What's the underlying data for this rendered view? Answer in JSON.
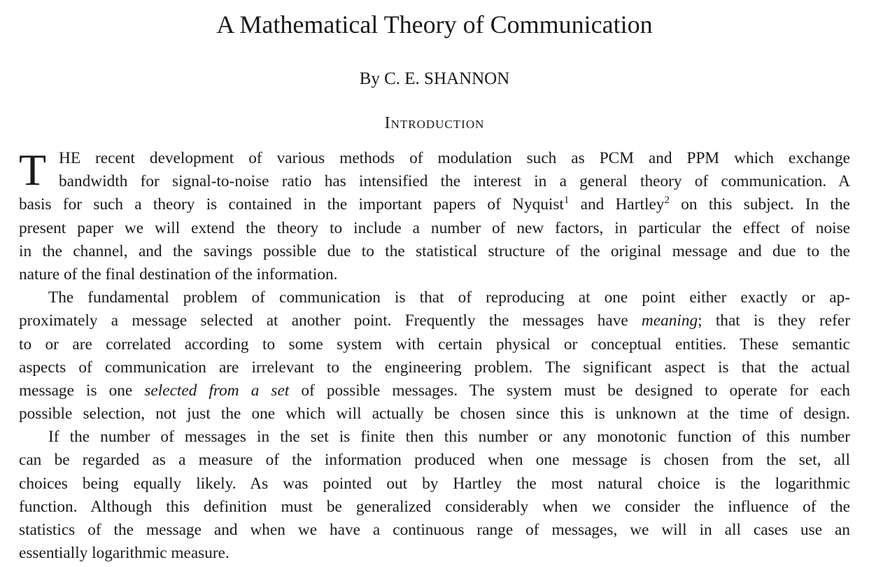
{
  "paper": {
    "title": "A Mathematical Theory of Communication",
    "author": "By C. E. SHANNON",
    "section_heading": "Introduction",
    "p1": {
      "dropcap": "T",
      "l1": "HE recent development of various methods of modulation such as PCM and PPM which exchange",
      "l2": "bandwidth for signal-to-noise ratio has intensified the interest in a general theory of communication. A",
      "l3a": "basis for such a theory is contained in the important papers of Nyquist",
      "l3_fn1": "1",
      "l3b": " and Hartley",
      "l3_fn2": "2",
      "l3c": " on this subject. In the",
      "l4": "present paper we will extend the theory to include a number of new factors, in particular the effect of noise",
      "l5": "in the channel, and the savings possible due to the statistical structure of the original message and due to the",
      "l6": "nature of the final destination of the information."
    },
    "p2": {
      "l1": "The fundamental problem of communication is that of reproducing at one point either exactly or ap-",
      "l2a": "proximately a message selected at another point. Frequently the messages have ",
      "l2_em": "meaning",
      "l2b": "; that is they refer",
      "l3": "to or are correlated according to some system with certain physical or conceptual entities. These semantic",
      "l4": "aspects of communication are irrelevant to the engineering problem. The significant aspect is that the actual",
      "l5a": "message is one ",
      "l5_em": "selected from a set",
      "l5b": " of possible messages. The system must be designed to operate for each",
      "l6": "possible selection, not just the one which will actually be chosen since this is unknown at the time of design."
    },
    "p3": {
      "l1": "If the number of messages in the set is finite then this number or any monotonic function of this number",
      "l2": "can be regarded as a measure of the information produced when one message is chosen from the set, all",
      "l3": "choices being equally likely. As was pointed out by Hartley the most natural choice is the logarithmic",
      "l4": "function. Although this definition must be generalized considerably when we consider the influence of the",
      "l5": "statistics of the message and when we have a continuous range of messages, we will in all cases use an",
      "l6": "essentially logarithmic measure."
    }
  }
}
